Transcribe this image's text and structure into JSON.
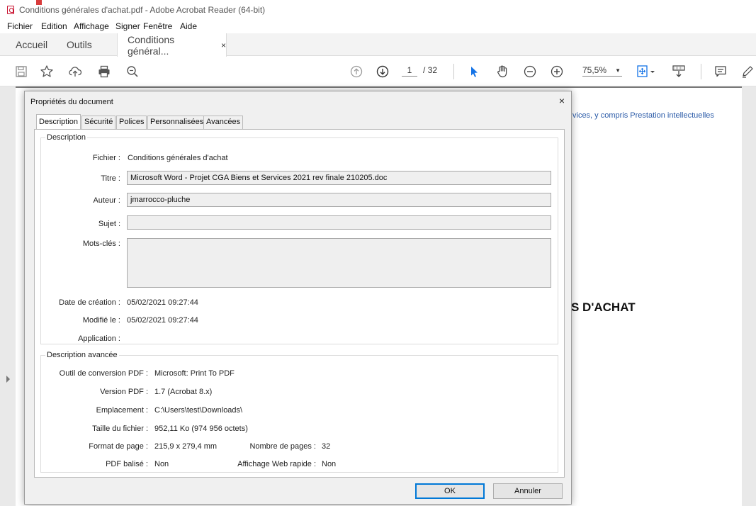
{
  "window": {
    "title": "Conditions générales d'achat.pdf - Adobe Acrobat Reader (64-bit)"
  },
  "menu": [
    "Fichier",
    "Edition",
    "Affichage",
    "Signer",
    "Fenêtre",
    "Aide"
  ],
  "tabs": {
    "home": "Accueil",
    "tools": "Outils",
    "document": "Conditions général...",
    "document_close": "×"
  },
  "toolbar": {
    "page_current": "1",
    "page_total": "/ 32",
    "zoom": "75,5%"
  },
  "document_page": {
    "link_text": "vices, y compris Prestation intellectuelles",
    "heading_text": "S D'ACHAT"
  },
  "dialog": {
    "title": "Propriétés du document",
    "close": "×",
    "tabs": [
      "Description",
      "Sécurité",
      "Polices",
      "Personnalisées",
      "Avancées"
    ],
    "description_group": {
      "legend": "Description",
      "file_label": "Fichier :",
      "file_value": "Conditions générales d'achat",
      "title_label": "Titre :",
      "title_value": "Microsoft Word - Projet CGA Biens et Services 2021 rev finale 210205.doc",
      "author_label": "Auteur :",
      "author_value": "jmarrocco-pluche",
      "subject_label": "Sujet :",
      "subject_value": "",
      "keywords_label": "Mots-clés :",
      "keywords_value": "",
      "created_label": "Date de création :",
      "created_value": "05/02/2021 09:27:44",
      "modified_label": "Modifié le :",
      "modified_value": "05/02/2021 09:27:44",
      "application_label": "Application :",
      "application_value": ""
    },
    "advanced_group": {
      "legend": "Description avancée",
      "producer_label": "Outil de conversion PDF :",
      "producer_value": "Microsoft: Print To PDF",
      "version_label": "Version PDF :",
      "version_value": "1.7 (Acrobat 8.x)",
      "location_label": "Emplacement :",
      "location_value": "C:\\Users\\test\\Downloads\\",
      "size_label": "Taille du fichier :",
      "size_value": "952,11 Ko (974 956 octets)",
      "pagesize_label": "Format de page :",
      "pagesize_value": "215,9 x 279,4 mm",
      "pagecount_label": "Nombre de pages :",
      "pagecount_value": "32",
      "tagged_label": "PDF balisé :",
      "tagged_value": "Non",
      "fastweb_label": "Affichage Web rapide :",
      "fastweb_value": "Non"
    },
    "ok_label": "OK",
    "cancel_label": "Annuler"
  }
}
